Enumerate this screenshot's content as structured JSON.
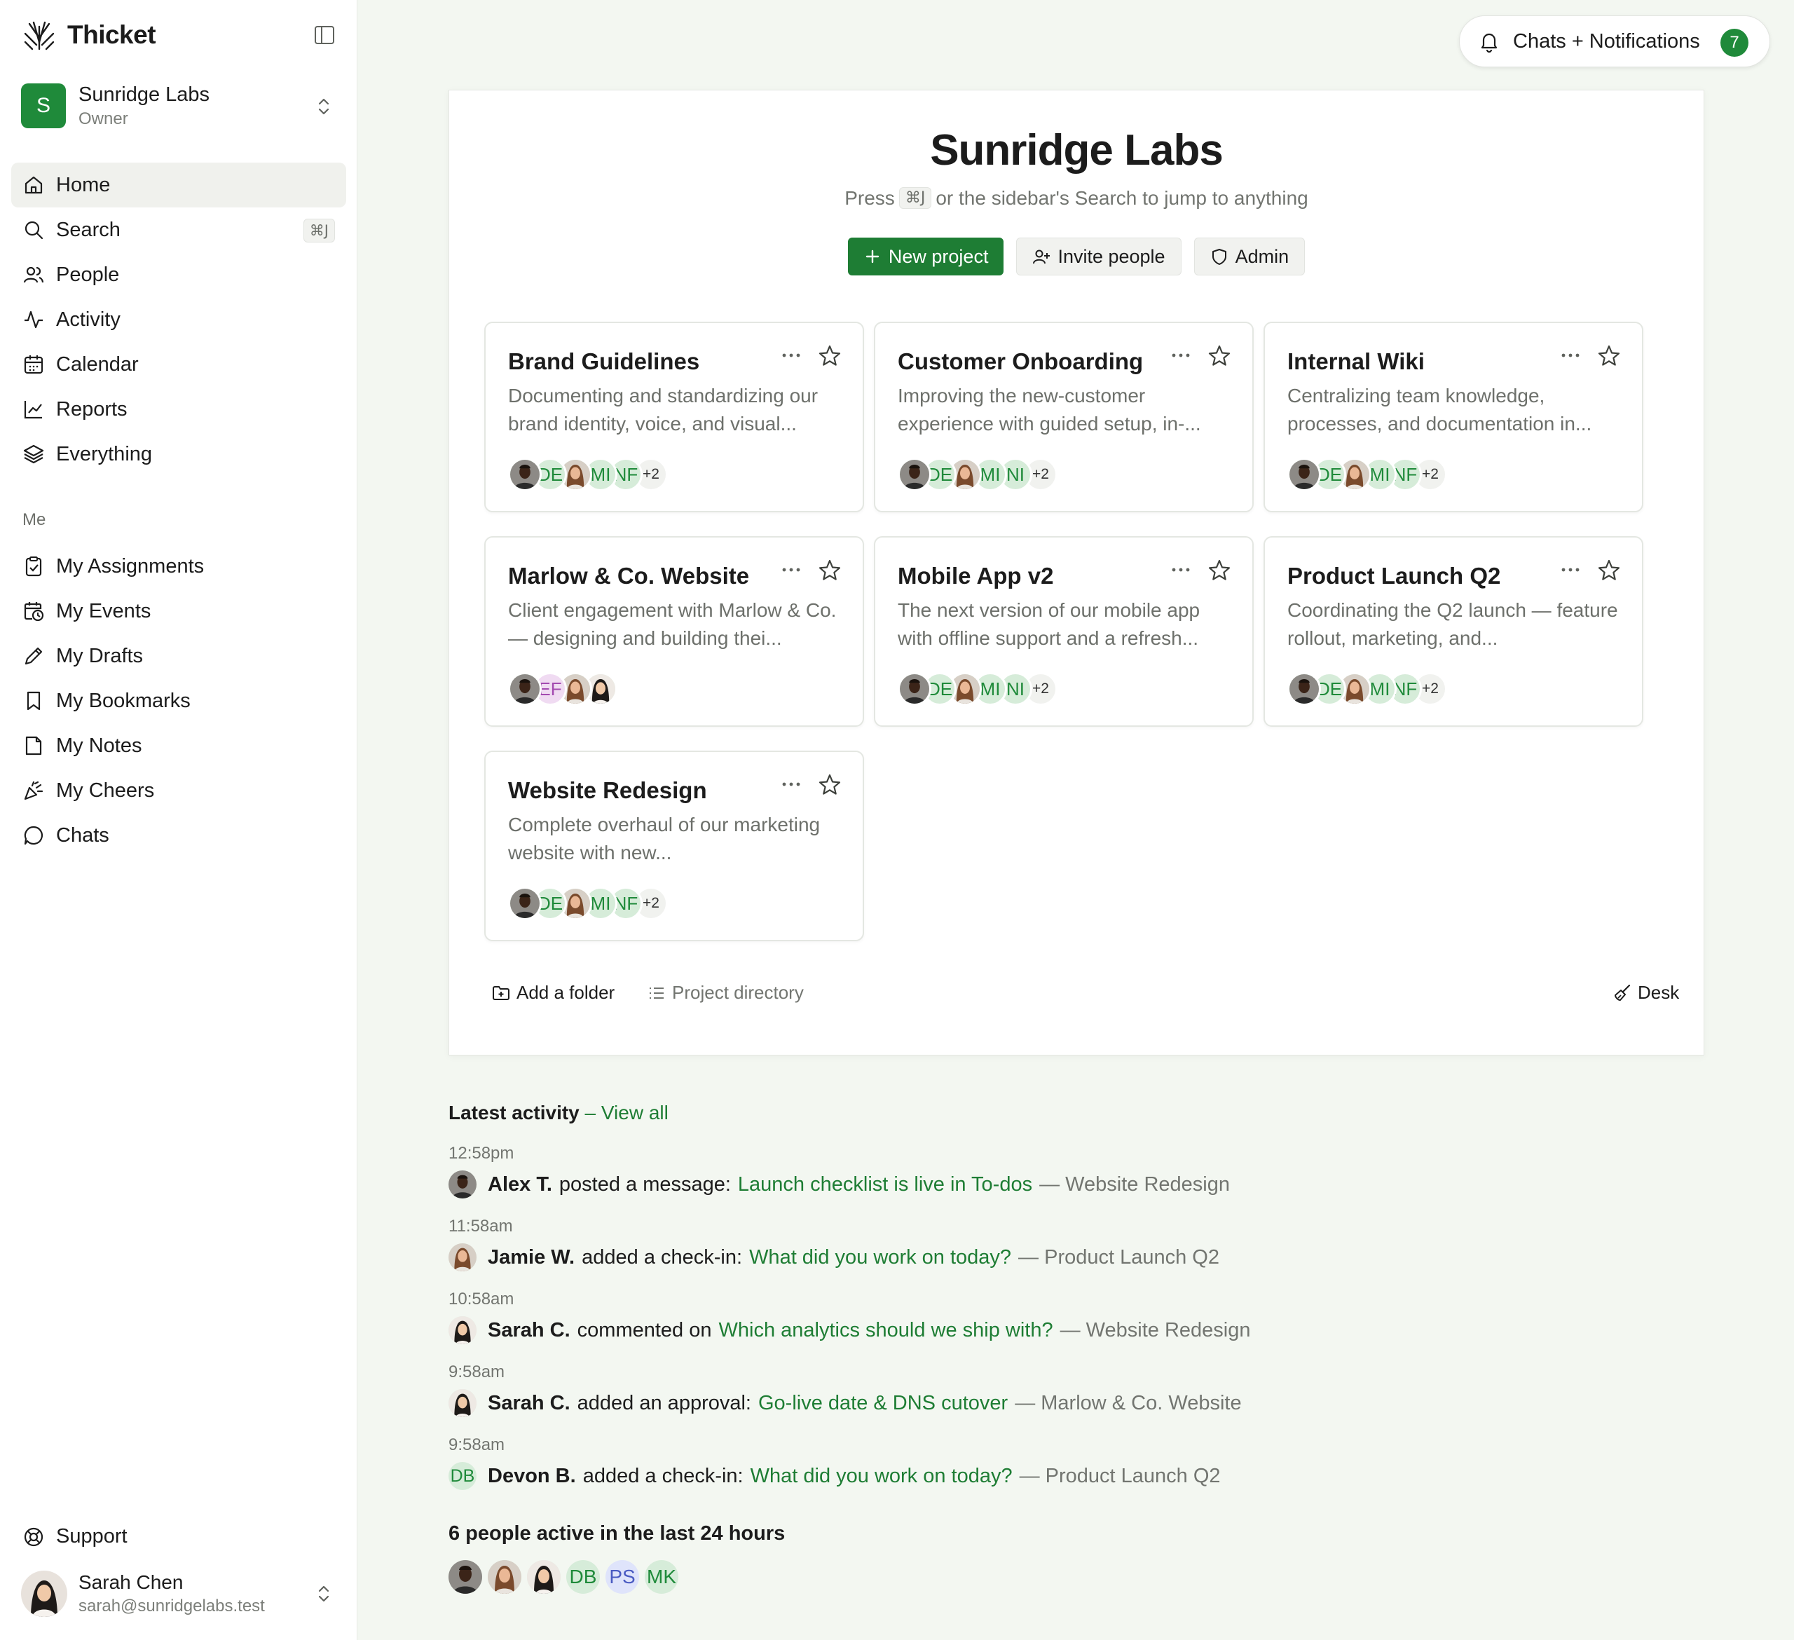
{
  "app": {
    "name": "Thicket"
  },
  "workspace": {
    "initial": "S",
    "name": "Sunridge Labs",
    "role": "Owner"
  },
  "nav": [
    {
      "label": "Home",
      "icon": "home-icon",
      "active": true
    },
    {
      "label": "Search",
      "icon": "search-icon",
      "shortcut": "⌘J"
    },
    {
      "label": "People",
      "icon": "people-icon"
    },
    {
      "label": "Activity",
      "icon": "activity-icon"
    },
    {
      "label": "Calendar",
      "icon": "calendar-icon"
    },
    {
      "label": "Reports",
      "icon": "chart-icon"
    },
    {
      "label": "Everything",
      "icon": "layers-icon"
    }
  ],
  "me_section": {
    "label": "Me",
    "items": [
      {
        "label": "My Assignments",
        "icon": "clipboard-check-icon"
      },
      {
        "label": "My Events",
        "icon": "calendar-clock-icon"
      },
      {
        "label": "My Drafts",
        "icon": "pencil-icon"
      },
      {
        "label": "My Bookmarks",
        "icon": "bookmark-icon"
      },
      {
        "label": "My Notes",
        "icon": "note-icon"
      },
      {
        "label": "My Cheers",
        "icon": "party-icon"
      },
      {
        "label": "Chats",
        "icon": "chat-icon"
      }
    ]
  },
  "support": {
    "label": "Support"
  },
  "user": {
    "name": "Sarah Chen",
    "email": "sarah@sunridgelabs.test"
  },
  "notifications": {
    "label": "Chats + Notifications",
    "count": "7"
  },
  "main": {
    "title": "Sunridge Labs",
    "subtitle_pre": "Press",
    "subtitle_kbd": "⌘J",
    "subtitle_post": "or the sidebar's Search to jump to anything",
    "buttons": {
      "new_project": "New project",
      "invite": "Invite people",
      "admin": "Admin"
    },
    "projects": [
      {
        "title": "Brand Guidelines",
        "desc": "Documenting and standardizing our brand identity, voice, and visual...",
        "avatars": [
          "photo-dark",
          "DE",
          "photo-woman",
          "MI",
          "NF"
        ],
        "more": "+2"
      },
      {
        "title": "Customer Onboarding",
        "desc": "Improving the new-customer experience with guided setup, in-...",
        "avatars": [
          "photo-dark",
          "DE",
          "photo-woman",
          "MI",
          "NI"
        ],
        "more": "+2"
      },
      {
        "title": "Internal Wiki",
        "desc": "Centralizing team knowledge, processes, and documentation in...",
        "avatars": [
          "photo-dark",
          "DE",
          "photo-woman",
          "MI",
          "NF"
        ],
        "more": "+2"
      },
      {
        "title": "Marlow & Co. Website",
        "desc": "Client engagement with Marlow & Co. — designing and building thei...",
        "avatars": [
          "photo-dark",
          "EF",
          "photo-woman",
          "photo-woman2"
        ],
        "more": ""
      },
      {
        "title": "Mobile App v2",
        "desc": "The next version of our mobile app with offline support and a refresh...",
        "avatars": [
          "photo-dark",
          "DE",
          "photo-woman",
          "MI",
          "NI"
        ],
        "more": "+2"
      },
      {
        "title": "Product Launch Q2",
        "desc": "Coordinating the Q2 launch — feature rollout, marketing, and...",
        "avatars": [
          "photo-dark",
          "DE",
          "photo-woman",
          "MI",
          "NF"
        ],
        "more": "+2"
      },
      {
        "title": "Website Redesign",
        "desc": "Complete overhaul of our marketing website with new...",
        "avatars": [
          "photo-dark",
          "DE",
          "photo-woman",
          "MI",
          "NF"
        ],
        "more": "+2"
      }
    ],
    "footer": {
      "add_folder": "Add a folder",
      "directory": "Project directory",
      "desk": "Desk"
    }
  },
  "activity": {
    "heading": "Latest activity",
    "sep": " – ",
    "view_all": "View all",
    "items": [
      {
        "time": "12:58pm",
        "who": "Alex T.",
        "action": "posted a message:",
        "link": "Launch checklist is live in To-dos",
        "project": "— Website Redesign",
        "avatar": "photo-dark"
      },
      {
        "time": "11:58am",
        "who": "Jamie W.",
        "action": "added a check-in:",
        "link": "What did you work on today?",
        "project": "— Product Launch Q2",
        "avatar": "photo-woman"
      },
      {
        "time": "10:58am",
        "who": "Sarah C.",
        "action": "commented on",
        "link": "Which analytics should we ship with?",
        "project": "— Website Redesign",
        "avatar": "photo-woman2"
      },
      {
        "time": "9:58am",
        "who": "Sarah C.",
        "action": "added an approval:",
        "link": "Go-live date & DNS cutover",
        "project": "— Marlow & Co. Website",
        "avatar": "photo-woman2"
      },
      {
        "time": "9:58am",
        "who": "Devon B.",
        "action": "added a check-in:",
        "link": "What did you work on today?",
        "project": "— Product Launch Q2",
        "avatar": "DB"
      }
    ],
    "active_heading": "6 people active in the last 24 hours",
    "active": [
      "photo-dark",
      "photo-woman",
      "photo-woman2",
      "DB",
      "PS",
      "MK"
    ]
  },
  "colors": {
    "accent": "#1e7d34",
    "background": "#f3f7f1"
  }
}
